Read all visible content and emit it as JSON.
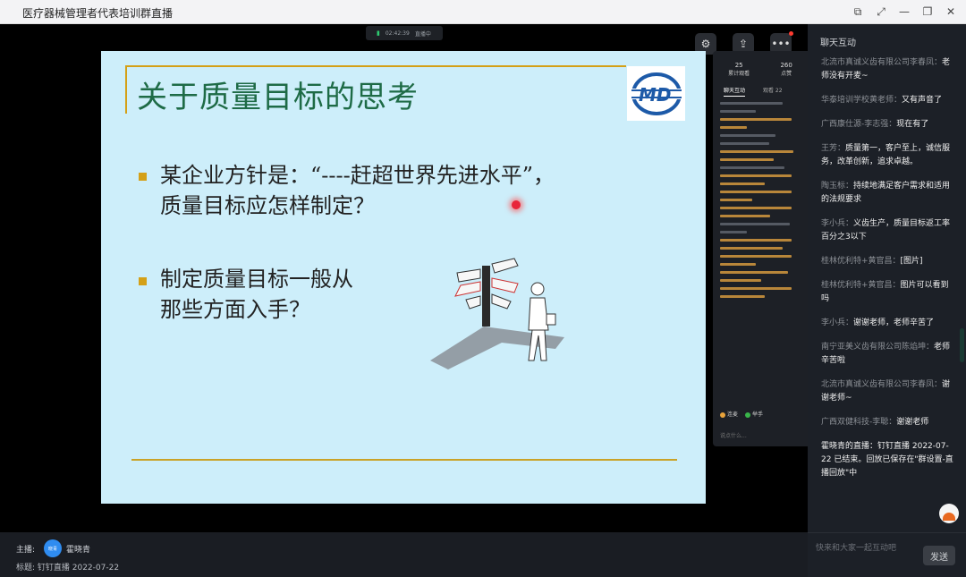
{
  "window": {
    "title": "医疗器械管理者代表培训群直播",
    "controls": [
      "popout-icon",
      "fullscreen-icon",
      "minimize-icon",
      "restore-icon",
      "close-icon"
    ]
  },
  "video": {
    "recording_time": "02:42:39",
    "recording_label": "直播中",
    "buttons": [
      "mic-settings-icon",
      "share-icon",
      "more-icon"
    ]
  },
  "slide": {
    "title": "关于质量目标的思考",
    "bullets": [
      {
        "line1": "某企业方针是：“----赶超世界先进水平”，",
        "line2": "质量目标应怎样制定？"
      },
      {
        "line1": "制定质量目标一般从",
        "line2": "那些方面入手？"
      }
    ],
    "colors": {
      "background": "#cdeefa",
      "title": "#1e6b46",
      "accent": "#d4a017"
    }
  },
  "mini_panel": {
    "stat1_value": "25",
    "stat1_label": "累计观看",
    "stat2_value": "260",
    "stat2_label": "点赞",
    "tab1": "聊天互动",
    "tab2": "观看 22",
    "footer1": "连麦",
    "footer2": "举手",
    "input_placeholder": "说点什么..."
  },
  "chat": {
    "title": "聊天互动",
    "messages": [
      {
        "author": "北流市真诚义齿有限公司李春凤：",
        "text": "老师没有开麦~"
      },
      {
        "author": "华泰培训学校黄老师：",
        "text": "又有声音了"
      },
      {
        "author": "广西康仕源-李志强：",
        "text": "现在有了"
      },
      {
        "author": "王芳：",
        "text": "质量第一，客户至上，诚信服务，改革创新，追求卓越。"
      },
      {
        "author": "陶玉标：",
        "text": "持续地满足客户需求和适用的法规要求"
      },
      {
        "author": "李小兵：",
        "text": "义齿生产，质量目标返工率百分之3以下"
      },
      {
        "author": "桂林优利特+黄官昌：",
        "text": "[图片]"
      },
      {
        "author": "桂林优利特+黄官昌：",
        "text": "图片可以看到吗"
      },
      {
        "author": "李小兵：",
        "text": "谢谢老师，老师辛苦了"
      },
      {
        "author": "南宁亚美义齿有限公司陈焰坤：",
        "text": "老师辛苦啦"
      },
      {
        "author": "北流市真诚义齿有限公司李春凤：",
        "text": "谢谢老师~"
      },
      {
        "author": "广西双健科技-李聪：",
        "text": "谢谢老师"
      },
      {
        "author": "霍晓青的直播：",
        "text": "钉钉直播 2022-07-22 已结束。回放已保存在\"群设置-直播回放\"中"
      }
    ],
    "live_badge": "直播"
  },
  "bottom": {
    "host_label": "主播:",
    "avatar_text": "晓青",
    "host_name": "霍晓青",
    "subject": "标题: 钉钉直播 2022-07-22"
  },
  "input": {
    "placeholder": "快来和大家一起互动吧",
    "send_label": "发送"
  }
}
